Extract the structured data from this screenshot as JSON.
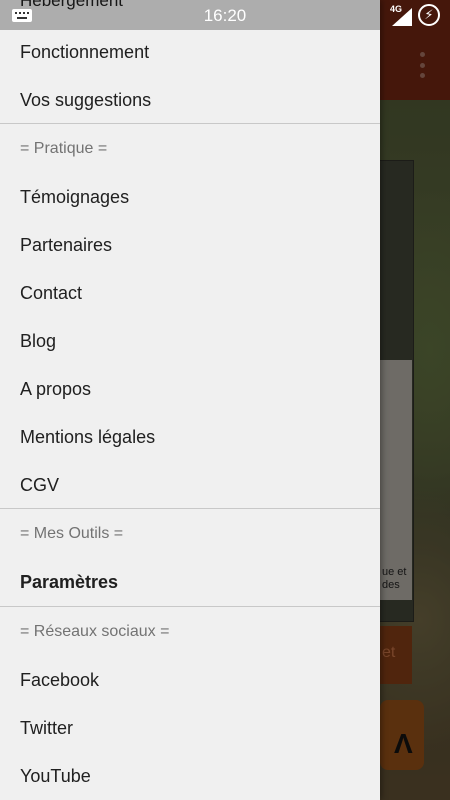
{
  "status_bar": {
    "time": "16:20",
    "network_label": "4G",
    "battery_icon": "battery-charging-icon",
    "keyboard_icon": "keyboard-icon"
  },
  "background_app": {
    "card_text": "ue et\ndes",
    "button_text": "et",
    "logo_text": "Λ",
    "menu_icon": "overflow-menu-icon"
  },
  "drawer": {
    "partial_item": "Hébergement",
    "items_top": [
      {
        "label": "Fonctionnement"
      },
      {
        "label": "Vos suggestions"
      }
    ],
    "sections": [
      {
        "header": "= Pratique =",
        "items": [
          {
            "label": "Témoignages"
          },
          {
            "label": "Partenaires"
          },
          {
            "label": "Contact"
          },
          {
            "label": "Blog"
          },
          {
            "label": "A propos"
          },
          {
            "label": "Mentions légales"
          },
          {
            "label": "CGV"
          }
        ]
      },
      {
        "header": "= Mes Outils =",
        "items": [
          {
            "label": "Paramètres"
          }
        ]
      },
      {
        "header": "= Réseaux sociaux =",
        "items": [
          {
            "label": "Facebook"
          },
          {
            "label": "Twitter"
          },
          {
            "label": "YouTube"
          }
        ]
      }
    ]
  },
  "colors": {
    "drawer_bg": "#f0f0f0",
    "toolbar": "#6b2412",
    "section_header": "#737373"
  }
}
